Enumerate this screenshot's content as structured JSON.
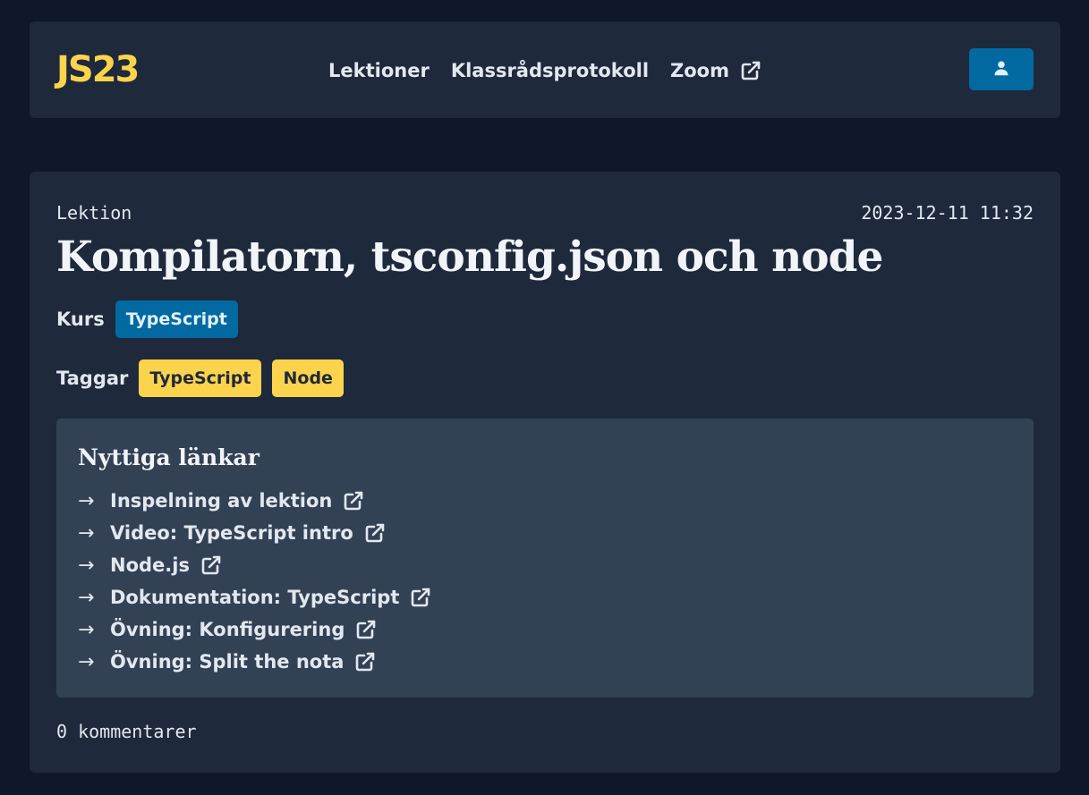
{
  "header": {
    "logo": "JS23",
    "nav": [
      {
        "label": "Lektioner",
        "external": false
      },
      {
        "label": "Klassrådsprotokoll",
        "external": false
      },
      {
        "label": "Zoom",
        "external": true
      }
    ],
    "user_icon": "user-icon"
  },
  "lesson": {
    "type_label": "Lektion",
    "date": "2023-12-11 11:32",
    "title": "Kompilatorn, tsconfig.json och node",
    "course_label": "Kurs",
    "course": "TypeScript",
    "tags_label": "Taggar",
    "tags": [
      "TypeScript",
      "Node"
    ]
  },
  "links": {
    "heading": "Nyttiga länkar",
    "arrow": "→",
    "items": [
      {
        "label": "Inspelning av lektion"
      },
      {
        "label": "Video: TypeScript intro"
      },
      {
        "label": "Node.js"
      },
      {
        "label": "Dokumentation: TypeScript"
      },
      {
        "label": "Övning: Konfigurering"
      },
      {
        "label": "Övning: Split the nota"
      }
    ]
  },
  "comments": {
    "count_text": "0 kommentarer"
  },
  "colors": {
    "background": "#0f172a",
    "surface": "#1e293b",
    "links_box": "#334155",
    "accent_blue": "#0369a1",
    "accent_yellow": "#fcd34d"
  }
}
